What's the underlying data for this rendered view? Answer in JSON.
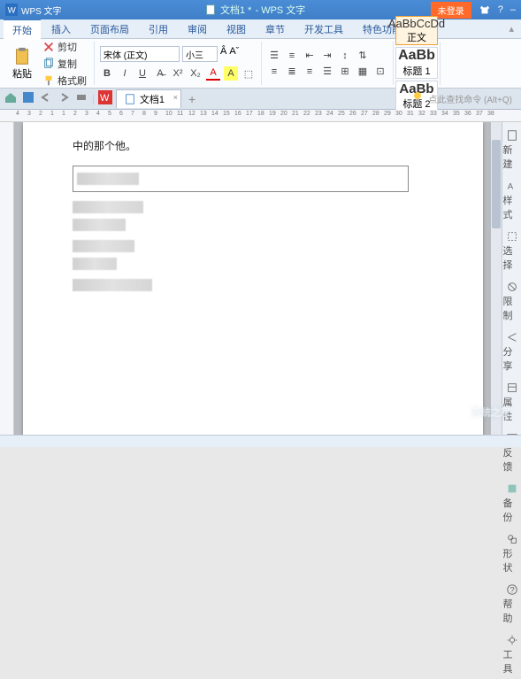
{
  "titlebar": {
    "app": "WPS 文字",
    "doc": "文档1 *",
    "suffix": "- WPS 文字",
    "login": "未登录"
  },
  "menu": {
    "tabs": [
      "开始",
      "插入",
      "页面布局",
      "引用",
      "审阅",
      "视图",
      "章节",
      "开发工具",
      "特色功能"
    ],
    "active": 0
  },
  "ribbon": {
    "clipboard": {
      "paste": "粘贴",
      "cut": "剪切",
      "copy": "复制",
      "format": "格式刷"
    },
    "font": {
      "name": "宋体 (正文)",
      "size": "小三",
      "bold": "B",
      "italic": "I",
      "underline": "U",
      "strike": "A"
    },
    "styles": [
      {
        "preview": "AaBbCcDd",
        "name": "正文"
      },
      {
        "preview": "AaBb",
        "name": "标题 1"
      },
      {
        "preview": "AaBb",
        "name": "标题 2"
      }
    ]
  },
  "tabbar": {
    "doc": "文档1",
    "hint": "点此查找命令 (Alt+Q)"
  },
  "ruler": {
    "marks": [
      "4",
      "3",
      "2",
      "1",
      "1",
      "2",
      "3",
      "4",
      "5",
      "6",
      "7",
      "8",
      "9",
      "10",
      "11",
      "12",
      "13",
      "14",
      "15",
      "16",
      "17",
      "18",
      "19",
      "20",
      "21",
      "22",
      "23",
      "24",
      "25",
      "26",
      "27",
      "28",
      "29",
      "30",
      "31",
      "32",
      "33",
      "34",
      "35",
      "36",
      "37",
      "38"
    ]
  },
  "document": {
    "line1": "中的那个他。"
  },
  "sidebar": {
    "items": [
      {
        "icon": "new",
        "label": "新建"
      },
      {
        "icon": "style",
        "label": "样式"
      },
      {
        "icon": "select",
        "label": "选择"
      },
      {
        "icon": "limit",
        "label": "限制"
      },
      {
        "icon": "share",
        "label": "分享"
      },
      {
        "icon": "props",
        "label": "属性"
      },
      {
        "icon": "feedback",
        "label": "反馈"
      },
      {
        "icon": "backup",
        "label": "备份"
      },
      {
        "icon": "shape",
        "label": "形状"
      },
      {
        "icon": "help",
        "label": "帮助"
      },
      {
        "icon": "tool",
        "label": "工具"
      }
    ]
  },
  "watermark": "系统之家"
}
